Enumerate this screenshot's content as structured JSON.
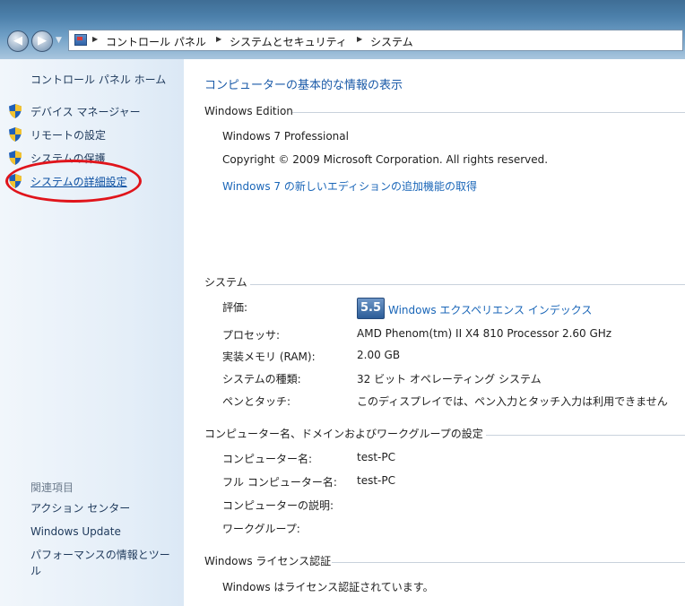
{
  "colors": {
    "link": "#1a66b8",
    "highlight_circle": "#e0141b",
    "title_bar": "#4b7faa"
  },
  "address_bar": {
    "crumbs": [
      "コントロール パネル",
      "システムとセキュリティ",
      "システム"
    ],
    "separator": "▶"
  },
  "nav": {
    "back_glyph": "◀",
    "forward_glyph": "▶",
    "history_glyph": "▼"
  },
  "sidebar": {
    "home": "コントロール パネル ホーム",
    "tasks": [
      {
        "label": "デバイス マネージャー",
        "icon": "shield-icon"
      },
      {
        "label": "リモートの設定",
        "icon": "shield-icon"
      },
      {
        "label": "システムの保護",
        "icon": "shield-icon"
      },
      {
        "label": "システムの詳細設定",
        "icon": "shield-icon"
      }
    ],
    "related_heading": "関連項目",
    "related": [
      "アクション センター",
      "Windows Update",
      "パフォーマンスの情報とツール"
    ]
  },
  "main": {
    "title": "コンピューターの基本的な情報の表示",
    "edition": {
      "heading": "Windows Edition",
      "name": "Windows 7 Professional",
      "copyright": "Copyright © 2009 Microsoft Corporation.  All rights reserved.",
      "upgrade_link": "Windows 7 の新しいエディションの追加機能の取得"
    },
    "system": {
      "heading": "システム",
      "rating_label": "評価:",
      "rating_score": "5.5",
      "rating_link": "Windows エクスペリエンス インデックス",
      "processor_label": "プロセッサ:",
      "processor": "AMD Phenom(tm) II X4 810 Processor   2.60 GHz",
      "ram_label": "実装メモリ (RAM):",
      "ram": "2.00 GB",
      "type_label": "システムの種類:",
      "type": "32 ビット オペレーティング システム",
      "pen_label": "ペンとタッチ:",
      "pen": "このディスプレイでは、ペン入力とタッチ入力は利用できません"
    },
    "computer": {
      "heading": "コンピューター名、ドメインおよびワークグループの設定",
      "name_label": "コンピューター名:",
      "name": "test-PC",
      "full_label": "フル コンピューター名:",
      "full": "test-PC",
      "desc_label": "コンピューターの説明:",
      "workgroup_label": "ワークグループ:"
    },
    "license": {
      "heading": "Windows ライセンス認証",
      "status": "Windows はライセンス認証されています。"
    }
  }
}
